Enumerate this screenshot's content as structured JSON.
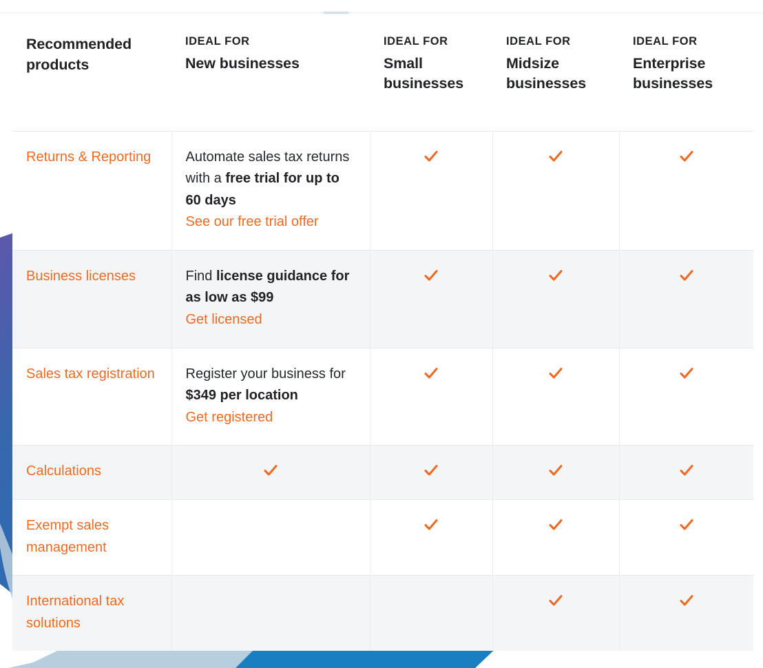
{
  "colors": {
    "accent_orange": "#ed6a22",
    "text_dark": "#1f2124",
    "body_text": "#25282b",
    "row_alt_bg": "#f4f5f6",
    "border": "#e6e8ea",
    "decor_purple": "#5b54a8",
    "decor_blue": "#2d6cb0",
    "decor_light_blue": "#b9cedd",
    "decor_deep_blue": "#1a7fc1"
  },
  "table": {
    "headers": [
      {
        "title": "Recommended products",
        "eyebrow": "",
        "subtitle": ""
      },
      {
        "title": "",
        "eyebrow": "IDEAL FOR",
        "subtitle": "New businesses"
      },
      {
        "title": "",
        "eyebrow": "IDEAL FOR",
        "subtitle": "Small businesses"
      },
      {
        "title": "",
        "eyebrow": "IDEAL FOR",
        "subtitle": "Midsize businesses"
      },
      {
        "title": "",
        "eyebrow": "IDEAL FOR",
        "subtitle": "Enterprise businesses"
      }
    ],
    "rows": [
      {
        "product": "Returns & Reporting",
        "new_business_text_before": "Automate sales tax returns with a ",
        "new_business_text_bold": "free trial for up to 60 days",
        "new_business_text_after": "",
        "cta": "See our free trial offer",
        "new_check": false,
        "small": true,
        "midsize": true,
        "enterprise": true
      },
      {
        "product": "Business licenses",
        "new_business_text_before": "Find ",
        "new_business_text_bold": "license guidance for as low as $99",
        "new_business_text_after": "",
        "cta": "Get licensed",
        "new_check": false,
        "small": true,
        "midsize": true,
        "enterprise": true
      },
      {
        "product": "Sales tax registration",
        "new_business_text_before": "Register your business for ",
        "new_business_text_bold": "$349 per location",
        "new_business_text_after": "",
        "cta": "Get registered",
        "new_check": false,
        "small": true,
        "midsize": true,
        "enterprise": true
      },
      {
        "product": "Calculations",
        "new_business_text_before": "",
        "new_business_text_bold": "",
        "new_business_text_after": "",
        "cta": "",
        "new_check": true,
        "small": true,
        "midsize": true,
        "enterprise": true
      },
      {
        "product": "Exempt sales management",
        "new_business_text_before": "",
        "new_business_text_bold": "",
        "new_business_text_after": "",
        "cta": "",
        "new_check": false,
        "small": true,
        "midsize": true,
        "enterprise": true
      },
      {
        "product": "International tax solutions",
        "new_business_text_before": "",
        "new_business_text_bold": "",
        "new_business_text_after": "",
        "cta": "",
        "new_check": false,
        "small": false,
        "midsize": true,
        "enterprise": true
      }
    ]
  }
}
